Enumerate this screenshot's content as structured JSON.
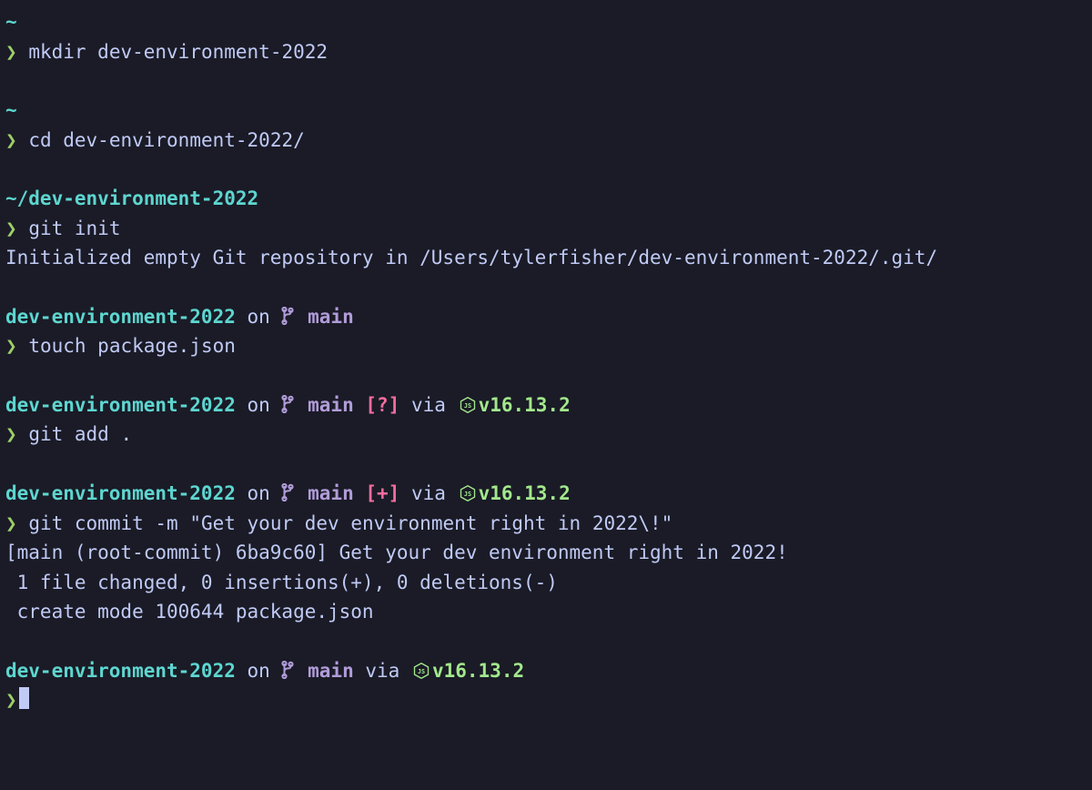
{
  "colors": {
    "bg": "#1a1b26",
    "fg": "#c0caf5",
    "cyan": "#5dd6d0",
    "lavender": "#b19cd9",
    "magenta": "#f66c9e",
    "green": "#a3e88c",
    "promptGreen": "#9ece6a"
  },
  "blocks": [
    {
      "cwd": "~",
      "promptChar": "❯",
      "command": "mkdir dev-environment-2022"
    },
    {
      "cwd": "~",
      "promptChar": "❯",
      "command": "cd dev-environment-2022/"
    },
    {
      "cwd": "~/dev-environment-2022",
      "promptChar": "❯",
      "command": "git init",
      "output": [
        "Initialized empty Git repository in /Users/tylerfisher/dev-environment-2022/.git/"
      ]
    },
    {
      "dir": "dev-environment-2022",
      "on": "on",
      "branch": "main",
      "promptChar": "❯",
      "command": "touch package.json"
    },
    {
      "dir": "dev-environment-2022",
      "on": "on",
      "branch": "main",
      "status": "[?]",
      "via": "via",
      "node": "v16.13.2",
      "promptChar": "❯",
      "command": "git add ."
    },
    {
      "dir": "dev-environment-2022",
      "on": "on",
      "branch": "main",
      "status": "[+]",
      "via": "via",
      "node": "v16.13.2",
      "promptChar": "❯",
      "command": "git commit -m \"Get your dev environment right in 2022\\!\"",
      "output": [
        "[main (root-commit) 6ba9c60] Get your dev environment right in 2022!",
        " 1 file changed, 0 insertions(+), 0 deletions(-)",
        " create mode 100644 package.json"
      ]
    },
    {
      "dir": "dev-environment-2022",
      "on": "on",
      "branch": "main",
      "via": "via",
      "node": "v16.13.2",
      "promptChar": "❯",
      "cursor": true
    }
  ]
}
